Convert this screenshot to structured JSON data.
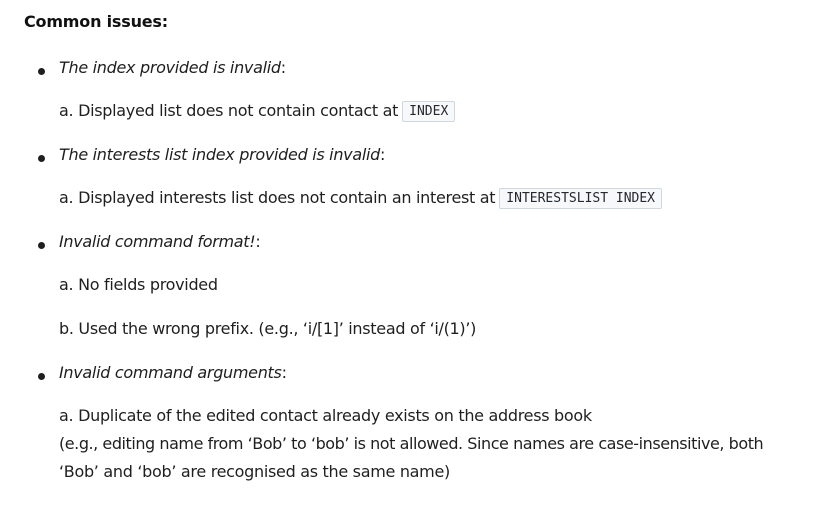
{
  "heading": "Common issues:",
  "issues": [
    {
      "title": "The index provided is invalid",
      "detail_a": "a. Displayed list does not contain contact at",
      "detail_a_code": "INDEX"
    },
    {
      "title": "The interests list index provided is invalid",
      "detail_a": "a. Displayed interests list does not contain an interest at",
      "detail_a_code": "INTERESTSLIST INDEX"
    },
    {
      "title": "Invalid command format!",
      "detail_a": "a. No fields provided",
      "detail_b": "b. Used the wrong prefix. (e.g., ‘i/[1]’ instead of ‘i/(1)’)"
    },
    {
      "title": "Invalid command arguments",
      "detail_a": "a. Duplicate of the edited contact already exists on the address book",
      "detail_a_line2": "(e.g., editing name from ‘Bob’ to ‘bob’ is not allowed. Since names are case-insensitive, both",
      "detail_a_line3": "‘Bob’ and ‘bob’ are recognised as the same name)"
    }
  ],
  "colon": ":"
}
